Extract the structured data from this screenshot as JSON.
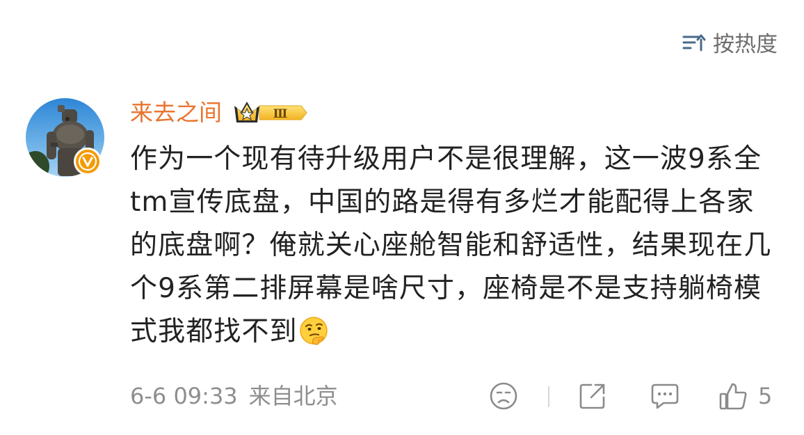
{
  "sort": {
    "label": "按热度",
    "icon": "sort-icon"
  },
  "comment": {
    "username": "来去之间",
    "level_badge": "Ⅲ",
    "text": "作为一个现有待升级用户不是很理解，这一波9系全tm宣传底盘，中国的路是得有多烂才能配得上各家的底盘啊？俺就关心座舱智能和舒适性，结果现在几个9系第二排屏幕是啥尺寸，座椅是不是支持躺椅模式我都找不到",
    "emoji": "thinking-face-emoji",
    "timestamp": "6-6 09:33",
    "source": "来自北京",
    "likes": "5"
  },
  "actions": {
    "react_icon": "face-icon",
    "share_icon": "share-icon",
    "reply_icon": "comment-icon",
    "like_icon": "thumbs-up-icon"
  },
  "colors": {
    "username": "#e9742f",
    "verified": "#f59a00",
    "meta_gray": "#8e8e8e"
  }
}
